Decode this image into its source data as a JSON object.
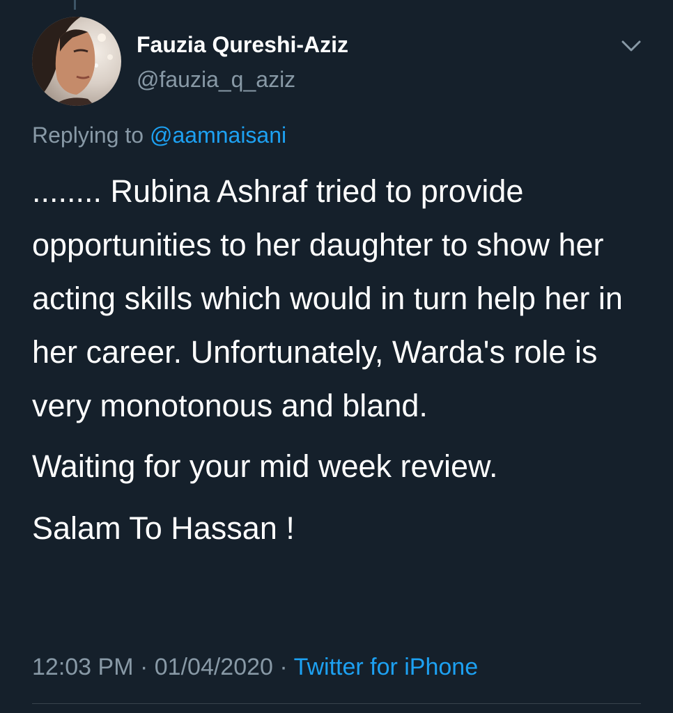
{
  "tweet": {
    "author": {
      "display_name": "Fauzia Qureshi-Aziz",
      "handle": "@fauzia_q_aziz",
      "avatar_icon": "profile-photo"
    },
    "replying_to": {
      "prefix": "Replying to",
      "mention": "@aamnaisani"
    },
    "body": {
      "paragraph_1": "........ Rubina Ashraf tried to provide opportunities to her daughter to show her acting skills which would in turn help her in her career. Unfortunately, Warda's role is very monotonous and bland.",
      "paragraph_2": "Waiting for your mid week review.",
      "paragraph_3": "Salam To Hassan !"
    },
    "meta": {
      "time": "12:03 PM",
      "separator": "·",
      "date": "01/04/2020",
      "source": "Twitter for iPhone"
    }
  },
  "colors": {
    "background": "#15202b",
    "primary_text": "#ffffff",
    "secondary_text": "#8899a6",
    "accent": "#1da1f2"
  },
  "icons": {
    "more_menu": "chevron-down-icon"
  }
}
